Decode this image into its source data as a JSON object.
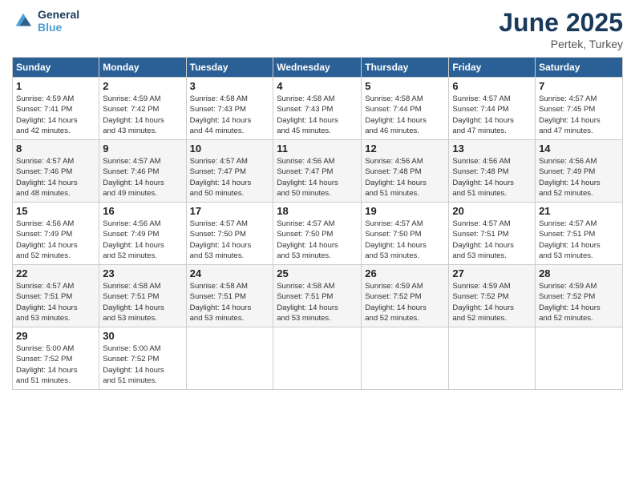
{
  "header": {
    "logo_line1": "General",
    "logo_line2": "Blue",
    "month_year": "June 2025",
    "location": "Pertek, Turkey"
  },
  "days_of_week": [
    "Sunday",
    "Monday",
    "Tuesday",
    "Wednesday",
    "Thursday",
    "Friday",
    "Saturday"
  ],
  "weeks": [
    [
      {
        "day": "1",
        "info": "Sunrise: 4:59 AM\nSunset: 7:41 PM\nDaylight: 14 hours\nand 42 minutes."
      },
      {
        "day": "2",
        "info": "Sunrise: 4:59 AM\nSunset: 7:42 PM\nDaylight: 14 hours\nand 43 minutes."
      },
      {
        "day": "3",
        "info": "Sunrise: 4:58 AM\nSunset: 7:43 PM\nDaylight: 14 hours\nand 44 minutes."
      },
      {
        "day": "4",
        "info": "Sunrise: 4:58 AM\nSunset: 7:43 PM\nDaylight: 14 hours\nand 45 minutes."
      },
      {
        "day": "5",
        "info": "Sunrise: 4:58 AM\nSunset: 7:44 PM\nDaylight: 14 hours\nand 46 minutes."
      },
      {
        "day": "6",
        "info": "Sunrise: 4:57 AM\nSunset: 7:44 PM\nDaylight: 14 hours\nand 47 minutes."
      },
      {
        "day": "7",
        "info": "Sunrise: 4:57 AM\nSunset: 7:45 PM\nDaylight: 14 hours\nand 47 minutes."
      }
    ],
    [
      {
        "day": "8",
        "info": "Sunrise: 4:57 AM\nSunset: 7:46 PM\nDaylight: 14 hours\nand 48 minutes."
      },
      {
        "day": "9",
        "info": "Sunrise: 4:57 AM\nSunset: 7:46 PM\nDaylight: 14 hours\nand 49 minutes."
      },
      {
        "day": "10",
        "info": "Sunrise: 4:57 AM\nSunset: 7:47 PM\nDaylight: 14 hours\nand 50 minutes."
      },
      {
        "day": "11",
        "info": "Sunrise: 4:56 AM\nSunset: 7:47 PM\nDaylight: 14 hours\nand 50 minutes."
      },
      {
        "day": "12",
        "info": "Sunrise: 4:56 AM\nSunset: 7:48 PM\nDaylight: 14 hours\nand 51 minutes."
      },
      {
        "day": "13",
        "info": "Sunrise: 4:56 AM\nSunset: 7:48 PM\nDaylight: 14 hours\nand 51 minutes."
      },
      {
        "day": "14",
        "info": "Sunrise: 4:56 AM\nSunset: 7:49 PM\nDaylight: 14 hours\nand 52 minutes."
      }
    ],
    [
      {
        "day": "15",
        "info": "Sunrise: 4:56 AM\nSunset: 7:49 PM\nDaylight: 14 hours\nand 52 minutes."
      },
      {
        "day": "16",
        "info": "Sunrise: 4:56 AM\nSunset: 7:49 PM\nDaylight: 14 hours\nand 52 minutes."
      },
      {
        "day": "17",
        "info": "Sunrise: 4:57 AM\nSunset: 7:50 PM\nDaylight: 14 hours\nand 53 minutes."
      },
      {
        "day": "18",
        "info": "Sunrise: 4:57 AM\nSunset: 7:50 PM\nDaylight: 14 hours\nand 53 minutes."
      },
      {
        "day": "19",
        "info": "Sunrise: 4:57 AM\nSunset: 7:50 PM\nDaylight: 14 hours\nand 53 minutes."
      },
      {
        "day": "20",
        "info": "Sunrise: 4:57 AM\nSunset: 7:51 PM\nDaylight: 14 hours\nand 53 minutes."
      },
      {
        "day": "21",
        "info": "Sunrise: 4:57 AM\nSunset: 7:51 PM\nDaylight: 14 hours\nand 53 minutes."
      }
    ],
    [
      {
        "day": "22",
        "info": "Sunrise: 4:57 AM\nSunset: 7:51 PM\nDaylight: 14 hours\nand 53 minutes."
      },
      {
        "day": "23",
        "info": "Sunrise: 4:58 AM\nSunset: 7:51 PM\nDaylight: 14 hours\nand 53 minutes."
      },
      {
        "day": "24",
        "info": "Sunrise: 4:58 AM\nSunset: 7:51 PM\nDaylight: 14 hours\nand 53 minutes."
      },
      {
        "day": "25",
        "info": "Sunrise: 4:58 AM\nSunset: 7:51 PM\nDaylight: 14 hours\nand 53 minutes."
      },
      {
        "day": "26",
        "info": "Sunrise: 4:59 AM\nSunset: 7:52 PM\nDaylight: 14 hours\nand 52 minutes."
      },
      {
        "day": "27",
        "info": "Sunrise: 4:59 AM\nSunset: 7:52 PM\nDaylight: 14 hours\nand 52 minutes."
      },
      {
        "day": "28",
        "info": "Sunrise: 4:59 AM\nSunset: 7:52 PM\nDaylight: 14 hours\nand 52 minutes."
      }
    ],
    [
      {
        "day": "29",
        "info": "Sunrise: 5:00 AM\nSunset: 7:52 PM\nDaylight: 14 hours\nand 51 minutes."
      },
      {
        "day": "30",
        "info": "Sunrise: 5:00 AM\nSunset: 7:52 PM\nDaylight: 14 hours\nand 51 minutes."
      },
      {
        "day": "",
        "info": ""
      },
      {
        "day": "",
        "info": ""
      },
      {
        "day": "",
        "info": ""
      },
      {
        "day": "",
        "info": ""
      },
      {
        "day": "",
        "info": ""
      }
    ]
  ]
}
